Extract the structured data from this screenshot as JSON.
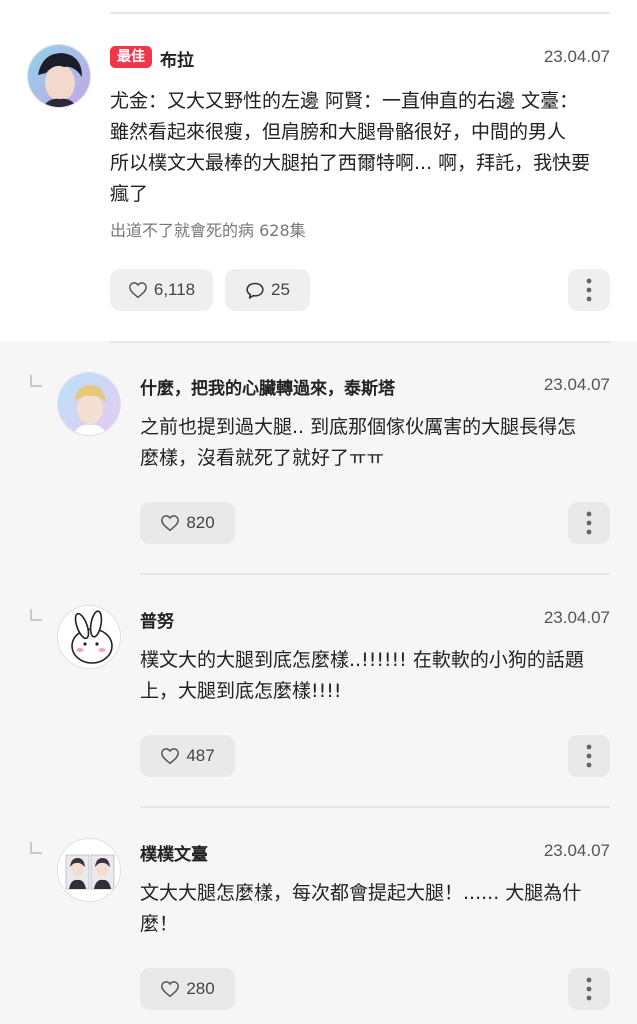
{
  "comments": [
    {
      "badge": "最佳",
      "username": "布拉",
      "date": "23.04.07",
      "lines": [
        "尤金：又大又野性的左邊 阿賢：一直伸直的右邊 文臺：",
        "雖然看起來很瘦，但肩膀和大腿骨骼很好，中間的男人",
        "所以樸文大最棒的大腿拍了西爾特啊... 啊，拜託，我快要",
        "瘋了"
      ],
      "meta": "出道不了就會死的病 628集",
      "likes": "6,118",
      "replies": "25"
    }
  ],
  "replies": [
    {
      "username": "什麼，把我的心臟轉過來，泰斯塔",
      "date": "23.04.07",
      "lines": [
        "之前也提到過大腿.. 到底那個傢伙厲害的大腿長得怎",
        "麼樣，沒看就死了就好了ㅠㅠ"
      ],
      "likes": "820"
    },
    {
      "username": "普努",
      "date": "23.04.07",
      "lines": [
        "樸文大的大腿到底怎麼樣..!!!!!! 在軟軟的小狗的話題",
        "上，大腿到底怎麼樣!!!!"
      ],
      "likes": "487"
    },
    {
      "username": "樸樸文臺",
      "date": "23.04.07",
      "lines": [
        "文大大腿怎麼樣，每次都會提起大腿！...... 大腿為什",
        "麼！"
      ],
      "likes": "280"
    }
  ],
  "icons": {
    "like": "heart-outline-icon",
    "comment": "speech-bubble-icon",
    "more": "vertical-dots-icon",
    "reply": "reply-corner-icon"
  },
  "colors": {
    "badge": "#f2364a",
    "reply_background": "#f6f6f6",
    "button_background": "#efefef"
  }
}
